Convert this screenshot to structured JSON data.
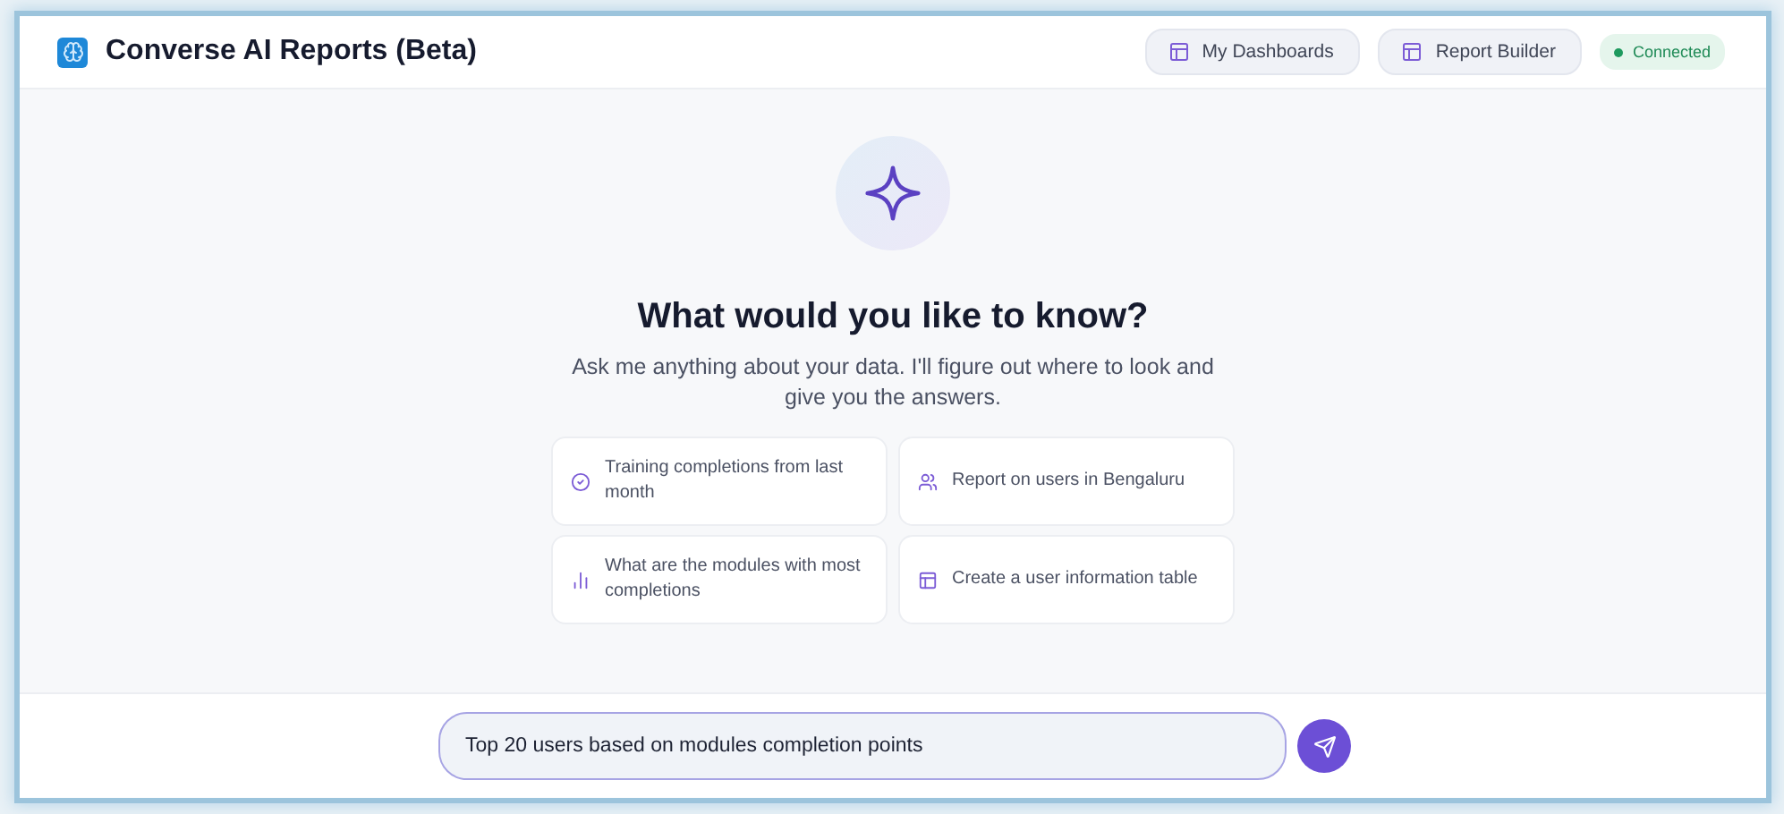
{
  "header": {
    "title": "Converse AI Reports (Beta)",
    "nav": [
      {
        "label": "My Dashboards"
      },
      {
        "label": "Report Builder"
      }
    ],
    "status": {
      "label": "Connected",
      "connected": true
    }
  },
  "hero": {
    "heading": "What would you like to know?",
    "subtitle": "Ask me anything about your data. I'll figure out where to look and give you the answers."
  },
  "suggestions": [
    {
      "kind": "check",
      "label": "Training completions from last month"
    },
    {
      "kind": "users",
      "label": "Report on users in Bengaluru"
    },
    {
      "kind": "chart",
      "label": "What are the modules with most completions"
    },
    {
      "kind": "table",
      "label": "Create a user information table"
    }
  ],
  "composer": {
    "value": "Top 20 users based on modules completion points"
  }
}
